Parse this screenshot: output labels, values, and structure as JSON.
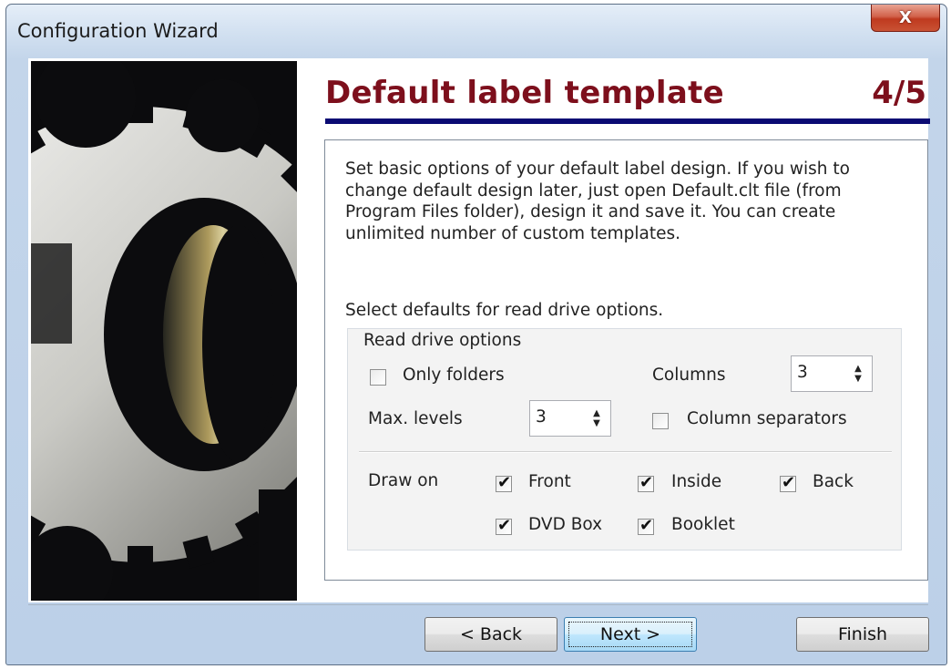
{
  "window": {
    "title": "Configuration Wizard",
    "close_label": "X"
  },
  "header": {
    "title": "Default label template",
    "step": "4/5"
  },
  "content": {
    "description": "Set basic options of your default label design. If you wish to change default design later, just open Default.clt file (from Program Files folder), design it and save it. You can create unlimited number of custom templates.",
    "select_text": "Select defaults for read drive options."
  },
  "read_drive": {
    "group_title": "Read drive options",
    "only_folders": {
      "label": "Only folders",
      "checked": false
    },
    "columns": {
      "label": "Columns",
      "value": "3"
    },
    "max_levels": {
      "label": "Max. levels",
      "value": "3"
    },
    "column_separators": {
      "label": "Column separators",
      "checked": false
    },
    "draw_on_label": "Draw on",
    "draw_on": [
      {
        "label": "Front",
        "checked": true
      },
      {
        "label": "Inside",
        "checked": true
      },
      {
        "label": "Back",
        "checked": true
      },
      {
        "label": "DVD Box",
        "checked": true
      },
      {
        "label": "Booklet",
        "checked": true
      }
    ]
  },
  "buttons": {
    "back": "< Back",
    "next": "Next >",
    "finish": "Finish"
  },
  "colors": {
    "heading": "#7d0f1c",
    "underline": "#0b0b73"
  }
}
